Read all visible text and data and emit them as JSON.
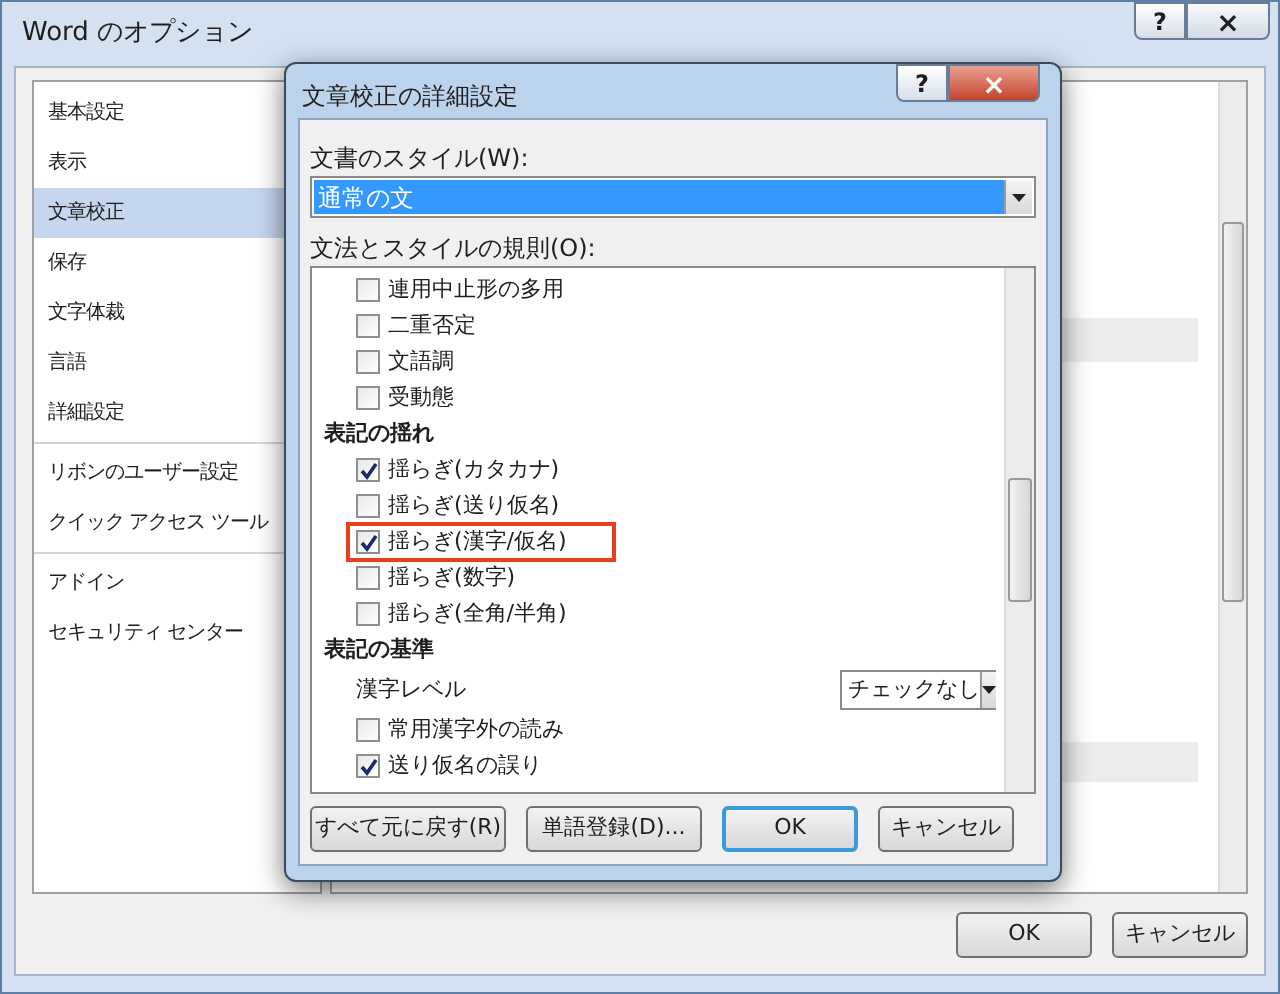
{
  "window": {
    "title": "Word のオプション",
    "buttons": [
      "?",
      "×"
    ]
  },
  "sidebar": {
    "groups": [
      [
        {
          "label": "基本設定",
          "selected": false
        },
        {
          "label": "表示",
          "selected": false
        },
        {
          "label": "文章校正",
          "selected": true
        },
        {
          "label": "保存",
          "selected": false
        },
        {
          "label": "文字体裁",
          "selected": false
        },
        {
          "label": "言語",
          "selected": false
        },
        {
          "label": "詳細設定",
          "selected": false
        }
      ],
      [
        {
          "label": "リボンのユーザー設定",
          "selected": false
        },
        {
          "label": "クイック アクセス ツール",
          "selected": false
        }
      ],
      [
        {
          "label": "アドイン",
          "selected": false
        },
        {
          "label": "セキュリティ センター",
          "selected": false
        }
      ]
    ]
  },
  "footer_buttons": [
    "OK",
    "キャンセル"
  ],
  "dialog": {
    "title": "文章校正の詳細設定",
    "title_buttons": [
      "?",
      "×"
    ],
    "style_label": "文書のスタイル(W):",
    "style_value": "通常の文",
    "rules_label": "文法とスタイルの規則(O):",
    "rules": [
      {
        "kind": "checkbox",
        "label": "連用中止形の多用",
        "checked": false,
        "highlighted": false
      },
      {
        "kind": "checkbox",
        "label": "二重否定",
        "checked": false,
        "highlighted": false
      },
      {
        "kind": "checkbox",
        "label": "文語調",
        "checked": false,
        "highlighted": false
      },
      {
        "kind": "checkbox",
        "label": "受動態",
        "checked": false,
        "highlighted": false
      },
      {
        "kind": "heading",
        "label": "表記の揺れ"
      },
      {
        "kind": "checkbox",
        "label": "揺らぎ(カタカナ)",
        "checked": true,
        "highlighted": false
      },
      {
        "kind": "checkbox",
        "label": "揺らぎ(送り仮名)",
        "checked": false,
        "highlighted": false
      },
      {
        "kind": "checkbox",
        "label": "揺らぎ(漢字/仮名)",
        "checked": true,
        "highlighted": true
      },
      {
        "kind": "checkbox",
        "label": "揺らぎ(数字)",
        "checked": false,
        "highlighted": false
      },
      {
        "kind": "checkbox",
        "label": "揺らぎ(全角/半角)",
        "checked": false,
        "highlighted": false
      },
      {
        "kind": "heading",
        "label": "表記の基準"
      },
      {
        "kind": "select",
        "label": "漢字レベル",
        "value": "チェックなし"
      },
      {
        "kind": "checkbox",
        "label": "常用漢字外の読み",
        "checked": false,
        "highlighted": false
      },
      {
        "kind": "checkbox",
        "label": "送り仮名の誤り",
        "checked": true,
        "highlighted": false
      }
    ],
    "buttons": [
      {
        "label": "すべて元に戻す(R)",
        "default": false
      },
      {
        "label": "単語登録(D)...",
        "default": false
      },
      {
        "label": "OK",
        "default": true
      },
      {
        "label": "キャンセル",
        "default": false
      }
    ]
  }
}
